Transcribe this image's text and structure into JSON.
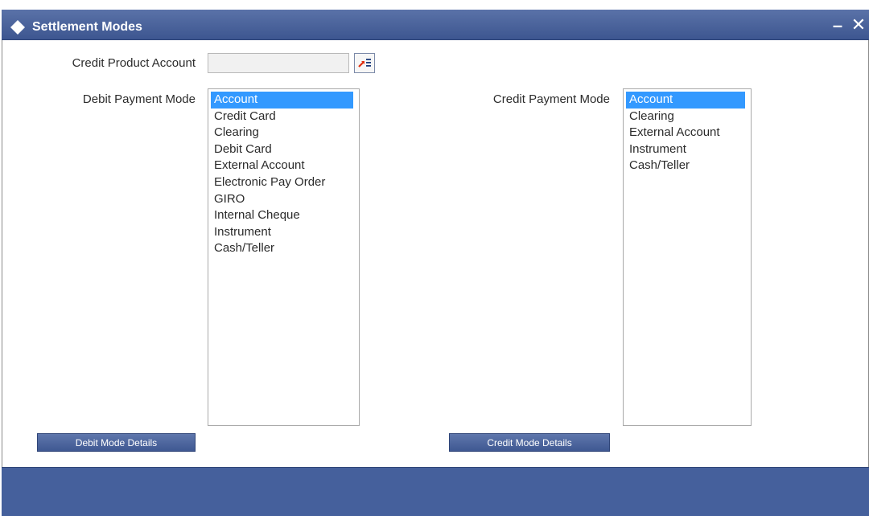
{
  "window": {
    "title": "Settlement Modes",
    "minimize_glyph": "–",
    "close_glyph": "✕"
  },
  "form": {
    "credit_product_account": {
      "label": "Credit Product Account",
      "value": ""
    },
    "debit_payment_mode": {
      "label": "Debit Payment Mode",
      "options": [
        "Account",
        "Credit Card",
        "Clearing",
        "Debit Card",
        "External Account",
        "Electronic Pay Order",
        "GIRO",
        "Internal Cheque",
        "Instrument",
        "Cash/Teller"
      ],
      "selected": "Account"
    },
    "credit_payment_mode": {
      "label": "Credit Payment Mode",
      "options": [
        "Account",
        "Clearing",
        "External Account",
        "Instrument",
        "Cash/Teller"
      ],
      "selected": "Account"
    }
  },
  "buttons": {
    "debit_mode_details": "Debit Mode Details",
    "credit_mode_details": "Credit Mode Details"
  },
  "colors": {
    "titlebar": "#4a62a0",
    "selection": "#3399ff",
    "footer": "#45609c"
  },
  "icons": {
    "title": "diamond-icon",
    "lookup": "list-lookup-icon"
  }
}
